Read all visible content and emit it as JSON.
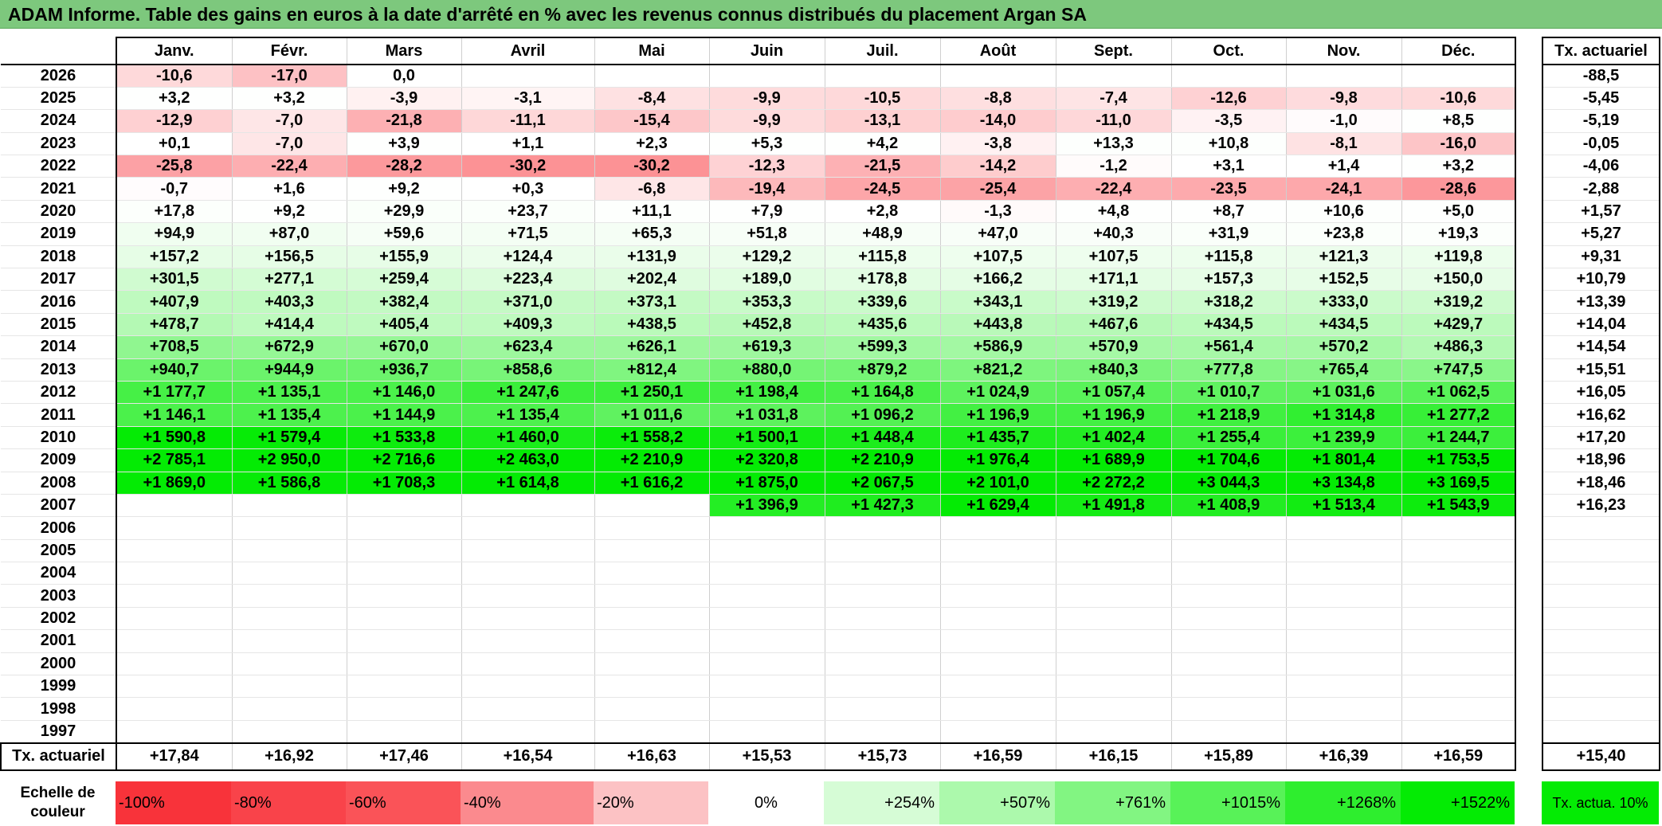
{
  "title": "ADAM Informe. Table des gains en euros à la date d'arrêté en % avec les revenus connus distribués du placement Argan SA",
  "header": {
    "months": [
      "Janv.",
      "Févr.",
      "Mars",
      "Avril",
      "Mai",
      "Juin",
      "Juil.",
      "Août",
      "Sept.",
      "Oct.",
      "Nov.",
      "Déc."
    ],
    "actuarial": "Tx. actuariel"
  },
  "rows": [
    {
      "year": "2026",
      "values": [
        "-10,6",
        "-17,0",
        "0,0",
        "",
        "",
        "",
        "",
        "",
        "",
        "",
        "",
        ""
      ],
      "actuarial": "-88,5"
    },
    {
      "year": "2025",
      "values": [
        "+3,2",
        "+3,2",
        "-3,9",
        "-3,1",
        "-8,4",
        "-9,9",
        "-10,5",
        "-8,8",
        "-7,4",
        "-12,6",
        "-9,8",
        "-10,6"
      ],
      "actuarial": "-5,45"
    },
    {
      "year": "2024",
      "values": [
        "-12,9",
        "-7,0",
        "-21,8",
        "-11,1",
        "-15,4",
        "-9,9",
        "-13,1",
        "-14,0",
        "-11,0",
        "-3,5",
        "-1,0",
        "+8,5"
      ],
      "actuarial": "-5,19"
    },
    {
      "year": "2023",
      "values": [
        "+0,1",
        "-7,0",
        "+3,9",
        "+1,1",
        "+2,3",
        "+5,3",
        "+4,2",
        "-3,8",
        "+13,3",
        "+10,8",
        "-8,1",
        "-16,0"
      ],
      "actuarial": "-0,05"
    },
    {
      "year": "2022",
      "values": [
        "-25,8",
        "-22,4",
        "-28,2",
        "-30,2",
        "-30,2",
        "-12,3",
        "-21,5",
        "-14,2",
        "-1,2",
        "+3,1",
        "+1,4",
        "+3,2"
      ],
      "actuarial": "-4,06"
    },
    {
      "year": "2021",
      "values": [
        "-0,7",
        "+1,6",
        "+9,2",
        "+0,3",
        "-6,8",
        "-19,4",
        "-24,5",
        "-25,4",
        "-22,4",
        "-23,5",
        "-24,1",
        "-28,6"
      ],
      "actuarial": "-2,88"
    },
    {
      "year": "2020",
      "values": [
        "+17,8",
        "+9,2",
        "+29,9",
        "+23,7",
        "+11,1",
        "+7,9",
        "+2,8",
        "-1,3",
        "+4,8",
        "+8,7",
        "+10,6",
        "+5,0"
      ],
      "actuarial": "+1,57"
    },
    {
      "year": "2019",
      "values": [
        "+94,9",
        "+87,0",
        "+59,6",
        "+71,5",
        "+65,3",
        "+51,8",
        "+48,9",
        "+47,0",
        "+40,3",
        "+31,9",
        "+23,8",
        "+19,3"
      ],
      "actuarial": "+5,27"
    },
    {
      "year": "2018",
      "values": [
        "+157,2",
        "+156,5",
        "+155,9",
        "+124,4",
        "+131,9",
        "+129,2",
        "+115,8",
        "+107,5",
        "+107,5",
        "+115,8",
        "+121,3",
        "+119,8"
      ],
      "actuarial": "+9,31"
    },
    {
      "year": "2017",
      "values": [
        "+301,5",
        "+277,1",
        "+259,4",
        "+223,4",
        "+202,4",
        "+189,0",
        "+178,8",
        "+166,2",
        "+171,1",
        "+157,3",
        "+152,5",
        "+150,0"
      ],
      "actuarial": "+10,79"
    },
    {
      "year": "2016",
      "values": [
        "+407,9",
        "+403,3",
        "+382,4",
        "+371,0",
        "+373,1",
        "+353,3",
        "+339,6",
        "+343,1",
        "+319,2",
        "+318,2",
        "+333,0",
        "+319,2"
      ],
      "actuarial": "+13,39"
    },
    {
      "year": "2015",
      "values": [
        "+478,7",
        "+414,4",
        "+405,4",
        "+409,3",
        "+438,5",
        "+452,8",
        "+435,6",
        "+443,8",
        "+467,6",
        "+434,5",
        "+434,5",
        "+429,7"
      ],
      "actuarial": "+14,04"
    },
    {
      "year": "2014",
      "values": [
        "+708,5",
        "+672,9",
        "+670,0",
        "+623,4",
        "+626,1",
        "+619,3",
        "+599,3",
        "+586,9",
        "+570,9",
        "+561,4",
        "+570,2",
        "+486,3"
      ],
      "actuarial": "+14,54"
    },
    {
      "year": "2013",
      "values": [
        "+940,7",
        "+944,9",
        "+936,7",
        "+858,6",
        "+812,4",
        "+880,0",
        "+879,2",
        "+821,2",
        "+840,3",
        "+777,8",
        "+765,4",
        "+747,5"
      ],
      "actuarial": "+15,51"
    },
    {
      "year": "2012",
      "values": [
        "+1 177,7",
        "+1 135,1",
        "+1 146,0",
        "+1 247,6",
        "+1 250,1",
        "+1 198,4",
        "+1 164,8",
        "+1 024,9",
        "+1 057,4",
        "+1 010,7",
        "+1 031,6",
        "+1 062,5"
      ],
      "actuarial": "+16,05"
    },
    {
      "year": "2011",
      "values": [
        "+1 146,1",
        "+1 135,4",
        "+1 144,9",
        "+1 135,4",
        "+1 011,6",
        "+1 031,8",
        "+1 096,2",
        "+1 196,9",
        "+1 196,9",
        "+1 218,9",
        "+1 314,8",
        "+1 277,2"
      ],
      "actuarial": "+16,62"
    },
    {
      "year": "2010",
      "values": [
        "+1 590,8",
        "+1 579,4",
        "+1 533,8",
        "+1 460,0",
        "+1 558,2",
        "+1 500,1",
        "+1 448,4",
        "+1 435,7",
        "+1 402,4",
        "+1 255,4",
        "+1 239,9",
        "+1 244,7"
      ],
      "actuarial": "+17,20"
    },
    {
      "year": "2009",
      "values": [
        "+2 785,1",
        "+2 950,0",
        "+2 716,6",
        "+2 463,0",
        "+2 210,9",
        "+2 320,8",
        "+2 210,9",
        "+1 976,4",
        "+1 689,9",
        "+1 704,6",
        "+1 801,4",
        "+1 753,5"
      ],
      "actuarial": "+18,96"
    },
    {
      "year": "2008",
      "values": [
        "+1 869,0",
        "+1 586,8",
        "+1 708,3",
        "+1 614,8",
        "+1 616,2",
        "+1 875,0",
        "+2 067,5",
        "+2 101,0",
        "+2 272,2",
        "+3 044,3",
        "+3 134,8",
        "+3 169,5"
      ],
      "actuarial": "+18,46"
    },
    {
      "year": "2007",
      "values": [
        "",
        "",
        "",
        "",
        "",
        "+1 396,9",
        "+1 427,3",
        "+1 629,4",
        "+1 491,8",
        "+1 408,9",
        "+1 513,4",
        "+1 543,9"
      ],
      "actuarial": "+16,23"
    },
    {
      "year": "2006",
      "values": [
        "",
        "",
        "",
        "",
        "",
        "",
        "",
        "",
        "",
        "",
        "",
        ""
      ],
      "actuarial": ""
    },
    {
      "year": "2005",
      "values": [
        "",
        "",
        "",
        "",
        "",
        "",
        "",
        "",
        "",
        "",
        "",
        ""
      ],
      "actuarial": ""
    },
    {
      "year": "2004",
      "values": [
        "",
        "",
        "",
        "",
        "",
        "",
        "",
        "",
        "",
        "",
        "",
        ""
      ],
      "actuarial": ""
    },
    {
      "year": "2003",
      "values": [
        "",
        "",
        "",
        "",
        "",
        "",
        "",
        "",
        "",
        "",
        "",
        ""
      ],
      "actuarial": ""
    },
    {
      "year": "2002",
      "values": [
        "",
        "",
        "",
        "",
        "",
        "",
        "",
        "",
        "",
        "",
        "",
        ""
      ],
      "actuarial": ""
    },
    {
      "year": "2001",
      "values": [
        "",
        "",
        "",
        "",
        "",
        "",
        "",
        "",
        "",
        "",
        "",
        ""
      ],
      "actuarial": ""
    },
    {
      "year": "2000",
      "values": [
        "",
        "",
        "",
        "",
        "",
        "",
        "",
        "",
        "",
        "",
        "",
        ""
      ],
      "actuarial": ""
    },
    {
      "year": "1999",
      "values": [
        "",
        "",
        "",
        "",
        "",
        "",
        "",
        "",
        "",
        "",
        "",
        ""
      ],
      "actuarial": ""
    },
    {
      "year": "1998",
      "values": [
        "",
        "",
        "",
        "",
        "",
        "",
        "",
        "",
        "",
        "",
        "",
        ""
      ],
      "actuarial": ""
    },
    {
      "year": "1997",
      "values": [
        "",
        "",
        "",
        "",
        "",
        "",
        "",
        "",
        "",
        "",
        "",
        ""
      ],
      "actuarial": ""
    }
  ],
  "footer": {
    "label": "Tx. actuariel",
    "values": [
      "+17,84",
      "+16,92",
      "+17,46",
      "+16,54",
      "+16,63",
      "+15,53",
      "+15,73",
      "+16,59",
      "+16,15",
      "+15,89",
      "+16,39",
      "+16,59"
    ],
    "actuarial": "+15,40"
  },
  "scale": {
    "label": "Echelle de couleur",
    "steps": [
      {
        "text": "-100%",
        "color": "#f8333a"
      },
      {
        "text": "-80%",
        "color": "#f9434a"
      },
      {
        "text": "-60%",
        "color": "#fa5358"
      },
      {
        "text": "-40%",
        "color": "#fb8a8e"
      },
      {
        "text": "-20%",
        "color": "#fcc2c4"
      },
      {
        "text": "0%",
        "color": "#ffffff"
      },
      {
        "text": "+254%",
        "color": "#d6fcd6"
      },
      {
        "text": "+507%",
        "color": "#acf9ac"
      },
      {
        "text": "+761%",
        "color": "#82f582"
      },
      {
        "text": "+1015%",
        "color": "#58f258"
      },
      {
        "text": "+1268%",
        "color": "#2eee2e"
      },
      {
        "text": "+1522%",
        "color": "#04eb04"
      }
    ],
    "last": {
      "text": "Tx. actua. 10%",
      "color": "#04eb04"
    }
  }
}
